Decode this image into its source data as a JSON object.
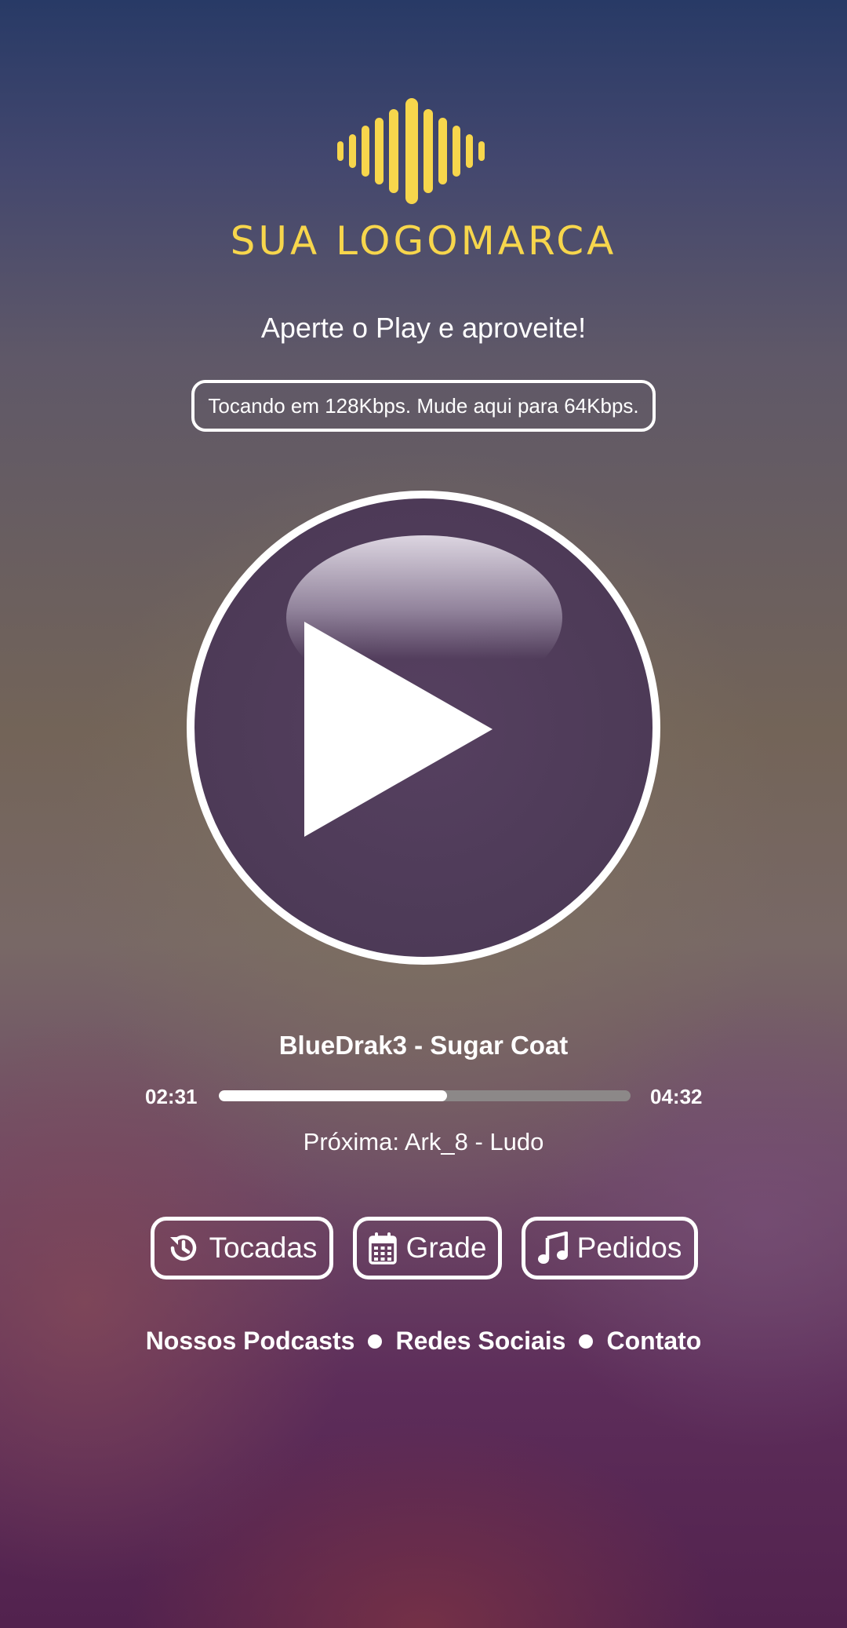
{
  "brand": {
    "logo_text": "SUA LOGOMARCA",
    "logo_color": "#f7d64c",
    "logo_icon": "sound-wave-icon"
  },
  "tagline": "Aperte o Play e aproveite!",
  "bitrate_toggle": "Tocando em 128Kbps. Mude aqui para 64Kbps.",
  "player": {
    "play_icon": "play-icon",
    "now_playing": "BlueDrak3 - Sugar Coat",
    "time_current": "02:31",
    "time_total": "04:32",
    "progress": 0.555,
    "next": "Próxima: Ark_8 - Ludo"
  },
  "actions": [
    {
      "label": "Tocadas",
      "icon": "history-icon"
    },
    {
      "label": "Grade",
      "icon": "calendar-icon"
    },
    {
      "label": "Pedidos",
      "icon": "music-note-icon"
    }
  ],
  "footer_links": [
    "Nossos Podcasts",
    "Redes Sociais",
    "Contato"
  ]
}
